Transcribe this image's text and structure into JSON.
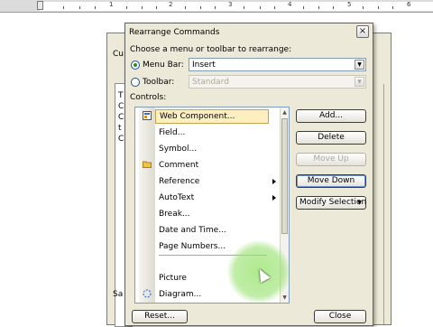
{
  "ruler": {
    "numbers": [
      "1",
      "2",
      "3",
      "4",
      "5",
      "6"
    ]
  },
  "background_dialog": {
    "title_fragment": "Cu",
    "side_chars": [
      "T",
      "C",
      "C",
      "t",
      "C"
    ],
    "bottom_fragment": "Sa"
  },
  "dialog": {
    "title": "Rearrange Commands",
    "close_glyph": "×",
    "prompt": "Choose a menu or toolbar to rearrange:",
    "menu_bar_label": "Menu Bar:",
    "menu_bar_value": "Insert",
    "toolbar_label": "Toolbar:",
    "toolbar_value": "Standard",
    "controls_label": "Controls:",
    "items": [
      {
        "label": "Web Component...",
        "icon": "web-component-icon",
        "selected": true
      },
      {
        "label": "Field...",
        "icon": "",
        "selected": false
      },
      {
        "label": "Symbol...",
        "icon": "",
        "selected": false
      },
      {
        "label": "Comment",
        "icon": "comment-icon",
        "selected": false
      },
      {
        "label": "Reference",
        "icon": "",
        "selected": false,
        "submenu": true
      },
      {
        "label": "AutoText",
        "icon": "",
        "selected": false,
        "submenu": true
      },
      {
        "label": "Break...",
        "icon": "",
        "selected": false
      },
      {
        "label": "Date and Time...",
        "icon": "",
        "selected": false
      },
      {
        "label": "Page Numbers...",
        "icon": "",
        "selected": false
      },
      {
        "label": "Picture",
        "icon": "",
        "selected": false
      },
      {
        "label": "Diagram...",
        "icon": "diagram-icon",
        "selected": false
      }
    ],
    "buttons": {
      "add": "Add...",
      "delete": "Delete",
      "move_up": "Move Up",
      "move_down": "Move Down",
      "modify_selection": "Modify Selection",
      "reset": "Reset...",
      "close": "Close"
    }
  },
  "colors": {
    "dialog_bg": "#ece9d8",
    "selection_bg": "#ffefc0",
    "cursor_highlight": "#a0e678"
  }
}
